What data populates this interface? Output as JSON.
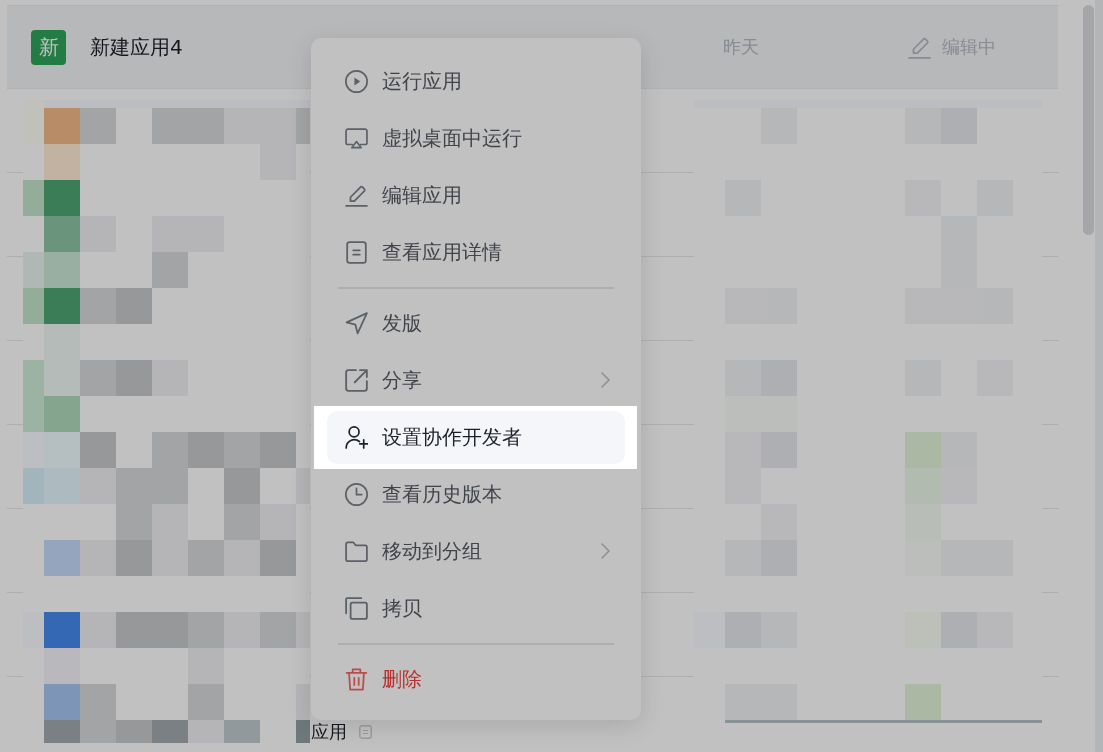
{
  "app_list": {
    "rows": [
      {
        "avatar": "新",
        "name": "新建应用4",
        "updated": "昨天",
        "status": "编辑中",
        "selected": true
      }
    ],
    "partial_row": {
      "name": "应用"
    }
  },
  "context_menu": {
    "groups": [
      {
        "items": [
          {
            "label": "运行应用",
            "kind": "normal",
            "submenu": false,
            "selected": false
          },
          {
            "label": "虚拟桌面中运行",
            "kind": "normal",
            "submenu": false,
            "selected": false
          },
          {
            "label": "编辑应用",
            "kind": "normal",
            "submenu": false,
            "selected": false
          },
          {
            "label": "查看应用详情",
            "kind": "normal",
            "submenu": false,
            "selected": false
          }
        ]
      },
      {
        "items": [
          {
            "label": "发版",
            "kind": "normal",
            "submenu": false,
            "selected": false
          },
          {
            "label": "分享",
            "kind": "normal",
            "submenu": true,
            "selected": false
          },
          {
            "label": "设置协作开发者",
            "kind": "normal",
            "submenu": false,
            "selected": true
          },
          {
            "label": "查看历史版本",
            "kind": "normal",
            "submenu": false,
            "selected": false
          },
          {
            "label": "移动到分组",
            "kind": "normal",
            "submenu": true,
            "selected": false
          },
          {
            "label": "拷贝",
            "kind": "normal",
            "submenu": false,
            "selected": false
          }
        ]
      },
      {
        "items": [
          {
            "label": "删除",
            "kind": "danger",
            "submenu": false,
            "selected": false
          }
        ]
      }
    ]
  }
}
